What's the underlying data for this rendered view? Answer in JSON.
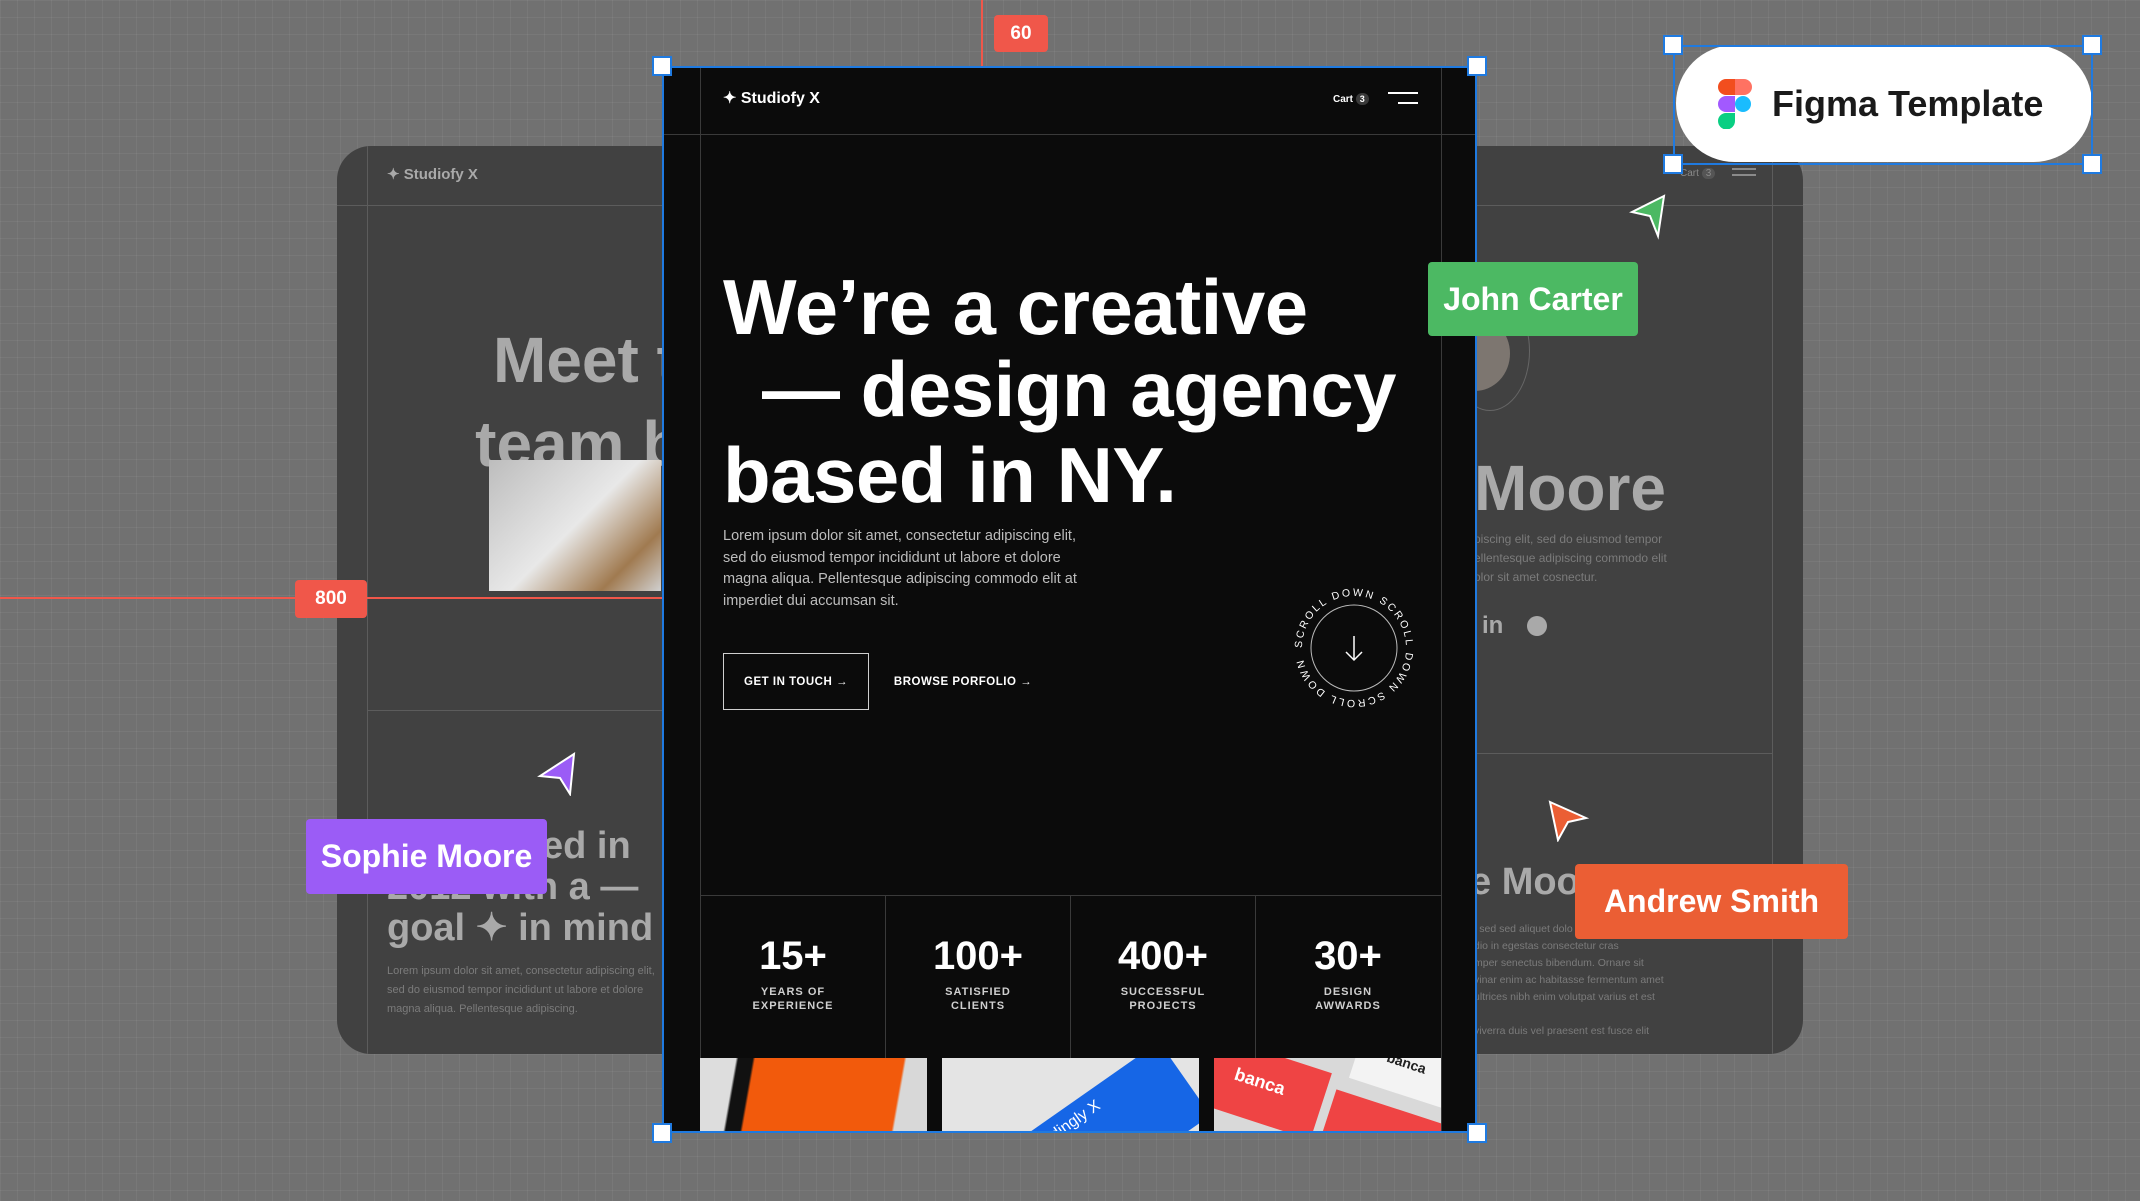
{
  "colors": {
    "canvas": "#717171",
    "frame": "#0b0b0b",
    "selection": "#1f7ae0",
    "ruler": "#f0574a",
    "john": "#4cb963",
    "sophie": "#9b5cf6",
    "andrew": "#eb5e34"
  },
  "rulers": {
    "top": "60",
    "left": "800"
  },
  "figma_badge": {
    "label": "Figma Template",
    "icon": "figma-logo-icon"
  },
  "cursors": [
    {
      "name": "John Carter"
    },
    {
      "name": "Sophie Moore"
    },
    {
      "name": "Andrew Smith"
    }
  ],
  "left_card": {
    "logo": "Studiofy X",
    "title_lines": [
      "Meet th",
      "team be"
    ],
    "section_lines": [
      "ed in",
      "2012 with a —",
      "goal ✦ in mind"
    ],
    "para": [
      "Lorem ipsum dolor sit amet, consectetur adipiscing elit,",
      "sed do eiusmod tempor incididunt ut labore et dolore",
      "magna aliqua. Pellentesque adipiscing."
    ]
  },
  "right_card": {
    "cart": "Cart",
    "cart_count": "3",
    "name": "Moore",
    "para": [
      "piscing elit, sed do eiusmod tempor",
      "ellentesque adipiscing commodo elit",
      "olor sit amet cosnectur."
    ],
    "social": [
      "in"
    ],
    "name2": "e Moo",
    "para2": [
      "l sed sed aliquet dolo",
      "dio in egestas consectetur cras",
      "mper senectus bibendum. Ornare sit",
      "vinar enim ac habitasse fermentum amet",
      "ultrices nibh enim volutpat varius et est",
      "",
      "viverra duis vel praesent est fusce elit"
    ]
  },
  "main": {
    "logo": "Studiofy X",
    "cart": "Cart",
    "cart_count": "3",
    "headline": [
      "We’re a creative",
      "— design agency",
      "based in NY."
    ],
    "paragraph": "Lorem ipsum dolor sit amet, consectetur adipiscing elit, sed do eiusmod tempor incididunt ut labore et dolore magna aliqua. Pellentesque adipiscing commodo elit at imperdiet dui accumsan sit.",
    "cta_primary": "GET IN TOUCH →",
    "cta_secondary": "BROWSE PORFOLIO →",
    "scroll_text": "SCROLL DOWN SCROLL DOWN SCROLL DOWN ",
    "stats": [
      {
        "value": "15+",
        "label1": "YEARS OF",
        "label2": "EXPERIENCE"
      },
      {
        "value": "100+",
        "label1": "SATISFIED",
        "label2": "CLIENTS"
      },
      {
        "value": "400+",
        "label1": "SUCCESSFUL",
        "label2": "PROJECTS"
      },
      {
        "value": "30+",
        "label1": "DESIGN",
        "label2": "AWWARDS"
      }
    ],
    "portfolio": {
      "img2_text": "andingly X",
      "img3_text": "banca",
      "img3_text2": "banca"
    }
  }
}
